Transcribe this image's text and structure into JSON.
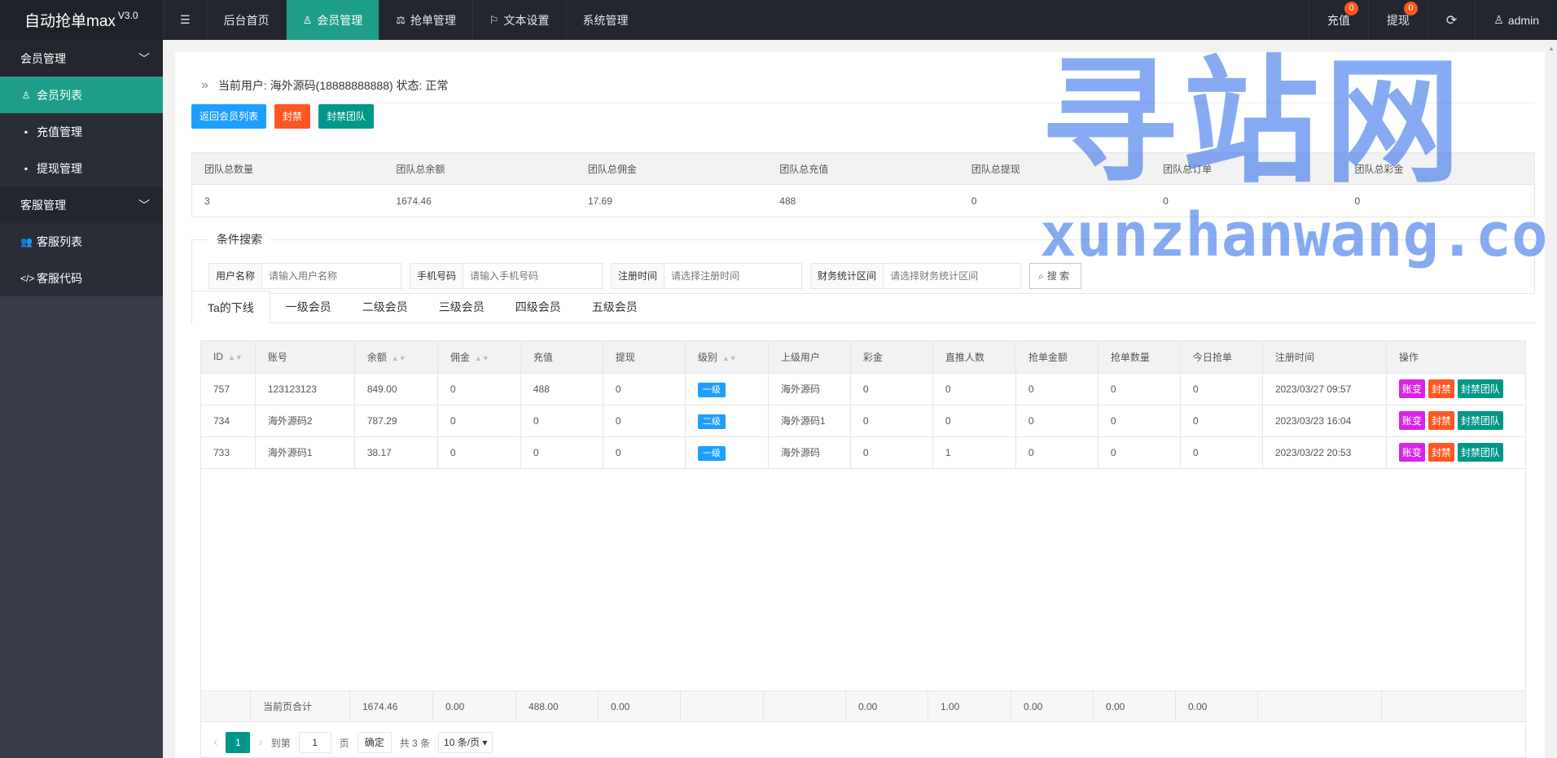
{
  "app": {
    "title": "自动抢单max",
    "version": "V3.0"
  },
  "topnav": {
    "items": [
      {
        "label": "后台首页"
      },
      {
        "label": "会员管理"
      },
      {
        "label": "抢单管理"
      },
      {
        "label": "文本设置"
      },
      {
        "label": "系统管理"
      }
    ]
  },
  "topright": {
    "recharge": "充值",
    "recharge_badge": "0",
    "withdraw": "提现",
    "withdraw_badge": "0",
    "user": "admin"
  },
  "sidebar": {
    "group1": "会员管理",
    "items1": [
      "会员列表",
      "充值管理",
      "提现管理"
    ],
    "group2": "客服管理",
    "items2": [
      "客服列表",
      "客服代码"
    ]
  },
  "info": {
    "text": "当前用户: 海外源码(18888888888) 状态: 正常"
  },
  "buttons": {
    "back": "返回会员列表",
    "ban": "封禁",
    "ban_team": "封禁团队"
  },
  "stats": {
    "headers": [
      "团队总数量",
      "团队总余额",
      "团队总佣金",
      "团队总充值",
      "团队总提现",
      "团队总订单",
      "团队总彩金"
    ],
    "values": [
      "3",
      "1674.46",
      "17.69",
      "488",
      "0",
      "0",
      "0"
    ]
  },
  "search": {
    "legend": "条件搜索",
    "username_label": "用户名称",
    "username_placeholder": "请输入用户名称",
    "phone_label": "手机号码",
    "phone_placeholder": "请输入手机号码",
    "regtime_label": "注册时间",
    "regtime_placeholder": "请选择注册时间",
    "finance_label": "财务统计区间",
    "finance_placeholder": "请选择财务统计区间",
    "button": "搜 索"
  },
  "tabs": [
    "Ta的下线",
    "一级会员",
    "二级会员",
    "三级会员",
    "四级会员",
    "五级会员"
  ],
  "table": {
    "headers": [
      "ID",
      "账号",
      "余额",
      "佣金",
      "充值",
      "提现",
      "级别",
      "上级用户",
      "彩金",
      "直推人数",
      "抢单金额",
      "抢单数量",
      "今日抢单",
      "注册时间",
      "操作"
    ],
    "rows": [
      {
        "id": "757",
        "account": "123123123",
        "balance": "849.00",
        "commission": "0",
        "recharge": "488",
        "withdraw": "0",
        "level": "一级",
        "parent": "海外源码",
        "bonus": "0",
        "direct": "0",
        "grab_amount": "0",
        "grab_count": "0",
        "today": "0",
        "reg_time": "2023/03/27 09:57"
      },
      {
        "id": "734",
        "account": "海外源码2",
        "balance": "787.29",
        "commission": "0",
        "recharge": "0",
        "withdraw": "0",
        "level": "二级",
        "parent": "海外源码1",
        "bonus": "0",
        "direct": "0",
        "grab_amount": "0",
        "grab_count": "0",
        "today": "0",
        "reg_time": "2023/03/23 16:04"
      },
      {
        "id": "733",
        "account": "海外源码1",
        "balance": "38.17",
        "commission": "0",
        "recharge": "0",
        "withdraw": "0",
        "level": "一级",
        "parent": "海外源码",
        "bonus": "0",
        "direct": "1",
        "grab_amount": "0",
        "grab_count": "0",
        "today": "0",
        "reg_time": "2023/03/22 20:53"
      }
    ],
    "ops": {
      "edit": "账变",
      "ban": "封禁",
      "ban_team": "封禁团队"
    },
    "total": {
      "label": "当前页合计",
      "balance": "1674.46",
      "commission": "0.00",
      "recharge": "488.00",
      "withdraw": "0.00",
      "bonus": "0.00",
      "direct": "1.00",
      "grab_amount": "0.00",
      "grab_count": "0.00",
      "today": "0.00"
    }
  },
  "pager": {
    "current": "1",
    "goto": "到第",
    "page_input": "1",
    "page_unit": "页",
    "confirm": "确定",
    "total": "共 3 条",
    "per_page": "10 条/页"
  },
  "watermark": {
    "big": "寻站网",
    "url": "xunzhanwang.com"
  }
}
